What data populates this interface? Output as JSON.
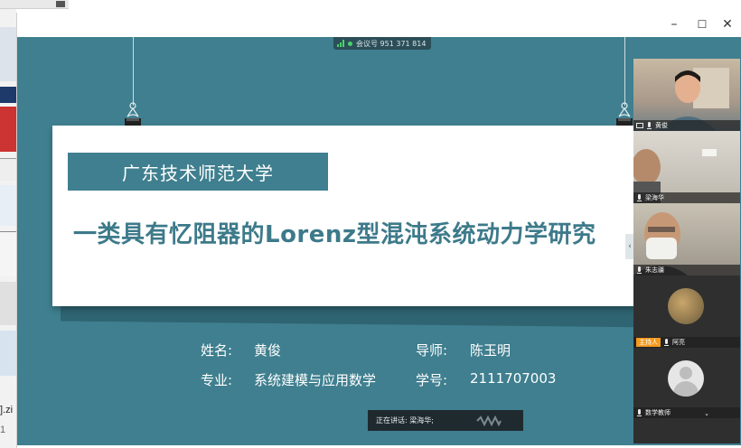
{
  "desktop": {
    "side_texts": [
      "].zi",
      "1"
    ]
  },
  "window": {
    "buttons": {
      "minimize": "–",
      "maximize": "☐",
      "close": "✕"
    },
    "meeting_id": "会议号 951 371 814"
  },
  "slide": {
    "university": "广东技术师范大学",
    "title": "一类具有忆阻器的Lorenz型混沌系统动力学研究",
    "name_label": "姓名:",
    "name_value": "黄俊",
    "advisor_label": "导师:",
    "advisor_value": "陈玉明",
    "major_label": "专业:",
    "major_value": "系统建模与应用数学",
    "id_label": "学号:",
    "id_value": "2111707003"
  },
  "speaking": {
    "text": "正在讲话: 梁海华;"
  },
  "participants": [
    {
      "name": "黄俊",
      "video": true
    },
    {
      "name": "梁海华",
      "video": true
    },
    {
      "name": "朱志疆",
      "video": true
    },
    {
      "name": "阿亮",
      "host_badge": "主持人",
      "video": false
    },
    {
      "name": "数学教师",
      "video": false
    }
  ],
  "colors": {
    "stage": "#3f7f8f",
    "title_text": "#3d7a8a",
    "host_badge": "#f39a1e",
    "speaking_bar": "#1f2a2f"
  }
}
